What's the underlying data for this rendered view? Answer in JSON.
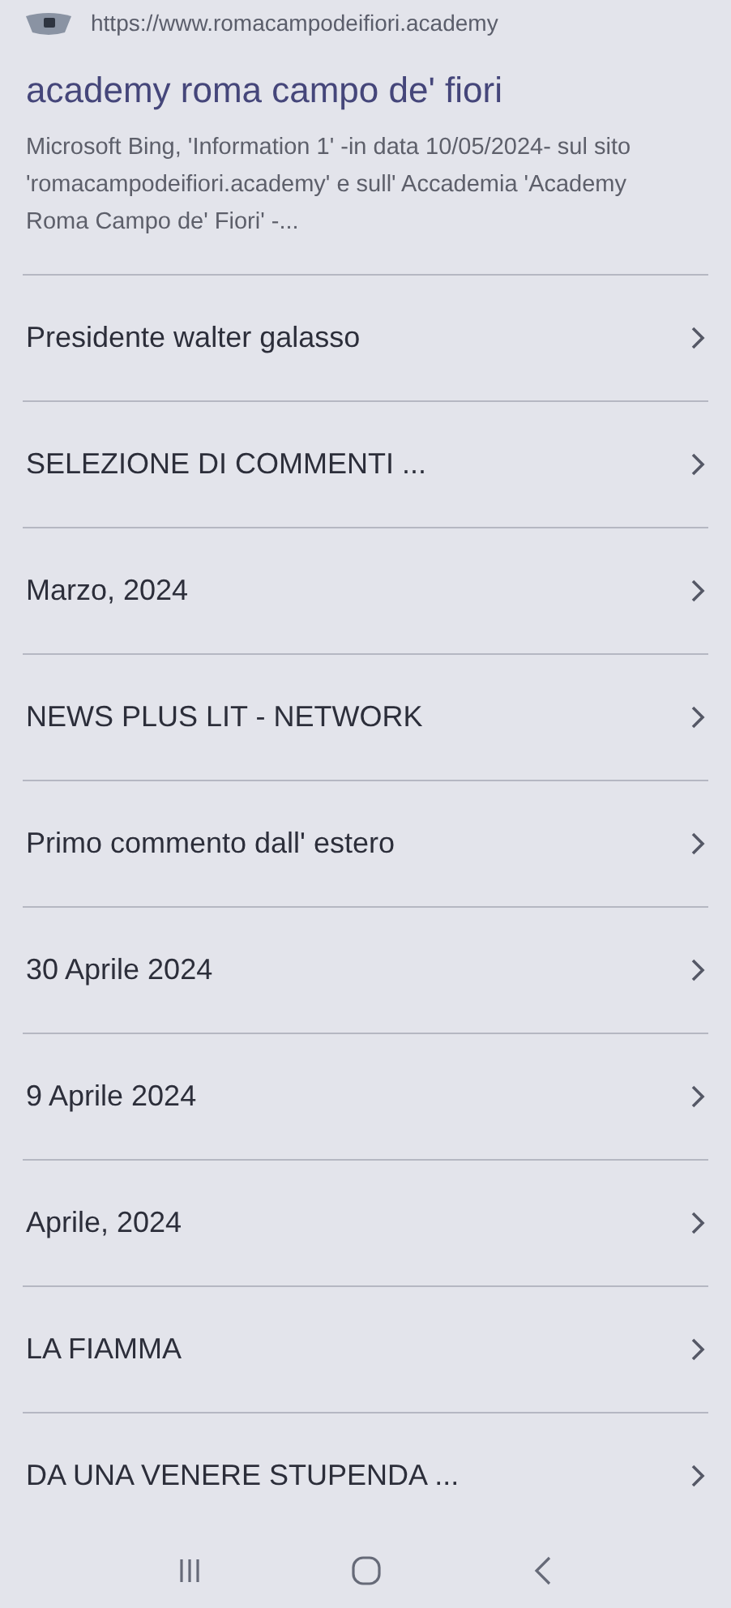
{
  "result": {
    "url": "https://www.romacampodeifiori.academy",
    "title": "academy roma campo de' fiori",
    "snippet": "Microsoft Bing, 'Information 1' -in data 10/05/2024- sul sito 'romacampodeifiori.academy' e sull' Accademia 'Academy Roma Campo de' Fiori' -..."
  },
  "links": [
    {
      "label": "Presidente walter galasso"
    },
    {
      "label": "SELEZIONE DI COMMENTI ..."
    },
    {
      "label": "Marzo, 2024"
    },
    {
      "label": "NEWS PLUS LIT - NETWORK"
    },
    {
      "label": "Primo commento dall' estero"
    },
    {
      "label": "30 Aprile 2024"
    },
    {
      "label": "9 Aprile 2024"
    },
    {
      "label": "Aprile, 2024"
    },
    {
      "label": "LA FIAMMA"
    },
    {
      "label": "DA UNA VENERE STUPENDA ..."
    }
  ]
}
